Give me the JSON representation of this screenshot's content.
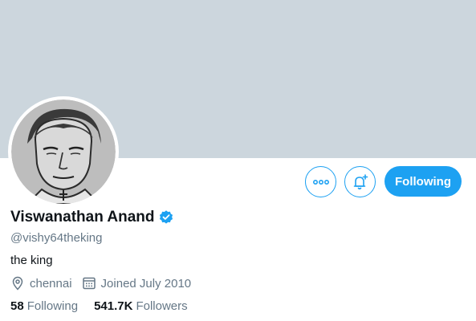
{
  "profile": {
    "name": "Viswanathan Anand",
    "handle": "@vishy64theking",
    "bio": "the king",
    "location": "chennai",
    "joined": "Joined July 2010",
    "verified": true
  },
  "stats": {
    "following_count": "58",
    "following_label": "Following",
    "followers_count": "541.7K",
    "followers_label": "Followers"
  },
  "actions": {
    "following_button": "Following",
    "more_icon": "more-icon",
    "notify_icon": "bell-plus-icon"
  },
  "colors": {
    "accent": "#1da1f2",
    "banner": "#ccd6dd",
    "secondary_text": "#657786"
  }
}
